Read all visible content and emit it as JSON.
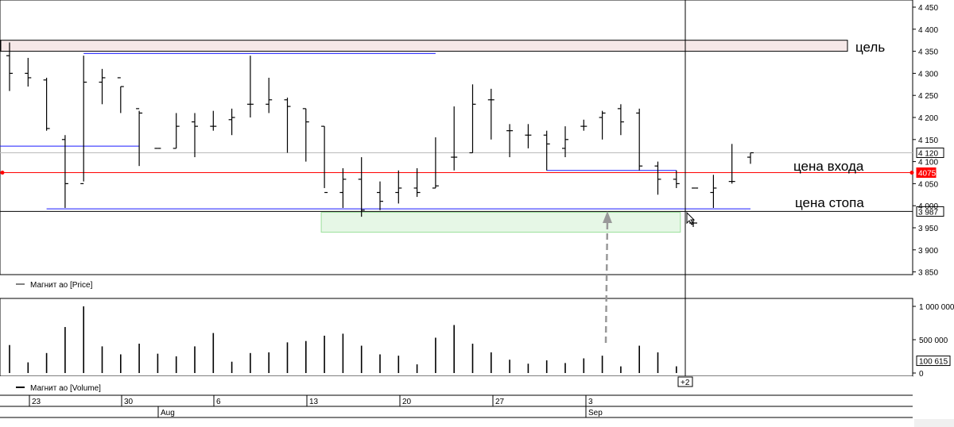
{
  "chart_data": [
    {
      "type": "ohlc",
      "legend": "Магнит ао [Price]",
      "ylim": [
        3840,
        4460
      ],
      "price_ticks": [
        4450,
        4400,
        4350,
        4300,
        4250,
        4200,
        4150,
        4100,
        4050,
        4000,
        3950,
        3900,
        3850
      ],
      "price_tick_labels": [
        "4 450",
        "4 400",
        "4 350",
        "4 300",
        "4 250",
        "4 200",
        "4 150",
        "4 100",
        "4 050",
        "4 000",
        "3 950",
        "3 900",
        "3 850"
      ],
      "bars": [
        {
          "date": "Jul 22",
          "o": 4340,
          "h": 4370,
          "l": 4260,
          "c": 4300
        },
        {
          "date": "Jul 23",
          "o": 4300,
          "h": 4335,
          "l": 4270,
          "c": 4290
        },
        {
          "date": "Jul 24",
          "o": 4285,
          "h": 4290,
          "l": 4170,
          "c": 4175
        },
        {
          "date": "Jul 25",
          "o": 4150,
          "h": 4160,
          "l": 3995,
          "c": 4050
        },
        {
          "date": "Jul 26",
          "o": 4050,
          "h": 4340,
          "l": 4055,
          "c": 4280
        },
        {
          "date": "Jul 29",
          "o": 4280,
          "h": 4310,
          "l": 4230,
          "c": 4290
        },
        {
          "date": "Jul 30",
          "o": 4290,
          "h": 4270,
          "l": 4210,
          "c": 4270
        },
        {
          "date": "Jul 31",
          "o": 4220,
          "h": 4215,
          "l": 4090,
          "c": 4210
        },
        {
          "date": "Aug 1",
          "o": 4130,
          "h": 4130,
          "l": 4130,
          "c": 4130
        },
        {
          "date": "Aug 2",
          "o": 4130,
          "h": 4210,
          "l": 4130,
          "c": 4180
        },
        {
          "date": "Aug 5",
          "o": 4190,
          "h": 4210,
          "l": 4110,
          "c": 4180
        },
        {
          "date": "Aug 6",
          "o": 4180,
          "h": 4215,
          "l": 4170,
          "c": 4180
        },
        {
          "date": "Aug 7",
          "o": 4195,
          "h": 4220,
          "l": 4160,
          "c": 4200
        },
        {
          "date": "Aug 8",
          "o": 4230,
          "h": 4340,
          "l": 4200,
          "c": 4230
        },
        {
          "date": "Aug 9",
          "o": 4230,
          "h": 4290,
          "l": 4210,
          "c": 4240
        },
        {
          "date": "Aug 12",
          "o": 4240,
          "h": 4245,
          "l": 4120,
          "c": 4225
        },
        {
          "date": "Aug 13",
          "o": 4220,
          "h": 4220,
          "l": 4100,
          "c": 4190
        },
        {
          "date": "Aug 14",
          "o": 4180,
          "h": 4180,
          "l": 4040,
          "c": 4030
        },
        {
          "date": "Aug 15",
          "o": 4030,
          "h": 4085,
          "l": 3995,
          "c": 4060
        },
        {
          "date": "Aug 16",
          "o": 4060,
          "h": 4110,
          "l": 3975,
          "c": 3990
        },
        {
          "date": "Aug 19",
          "o": 4030,
          "h": 4055,
          "l": 3990,
          "c": 4010
        },
        {
          "date": "Aug 20",
          "o": 4030,
          "h": 4080,
          "l": 4005,
          "c": 4040
        },
        {
          "date": "Aug 21",
          "o": 4040,
          "h": 4085,
          "l": 4020,
          "c": 4030
        },
        {
          "date": "Aug 22",
          "o": 4040,
          "h": 4155,
          "l": 4040,
          "c": 4045
        },
        {
          "date": "Aug 23",
          "o": 4110,
          "h": 4225,
          "l": 4080,
          "c": 4110
        },
        {
          "date": "Aug 26",
          "o": 4120,
          "h": 4275,
          "l": 4120,
          "c": 4230
        },
        {
          "date": "Aug 27",
          "o": 4240,
          "h": 4265,
          "l": 4150,
          "c": 4240
        },
        {
          "date": "Aug 28",
          "o": 4170,
          "h": 4185,
          "l": 4110,
          "c": 4170
        },
        {
          "date": "Aug 29",
          "o": 4160,
          "h": 4185,
          "l": 4130,
          "c": 4160
        },
        {
          "date": "Aug 30",
          "o": 4160,
          "h": 4170,
          "l": 4080,
          "c": 4140
        },
        {
          "date": "Aug 31",
          "o": 4130,
          "h": 4180,
          "l": 4110,
          "c": 4150
        },
        {
          "date": "Sep 1",
          "o": 4180,
          "h": 4195,
          "l": 4170,
          "c": 4180
        },
        {
          "date": "Sep 2",
          "o": 4200,
          "h": 4215,
          "l": 4150,
          "c": 4210
        },
        {
          "date": "Sep 3",
          "o": 4220,
          "h": 4230,
          "l": 4160,
          "c": 4190
        },
        {
          "date": "Sep 4",
          "o": 4210,
          "h": 4220,
          "l": 4080,
          "c": 4090
        },
        {
          "date": "Sep 5",
          "o": 4090,
          "h": 4100,
          "l": 4025,
          "c": 4060
        },
        {
          "date": "Sep 6",
          "o": 4060,
          "h": 4080,
          "l": 4040,
          "c": 4050
        },
        {
          "date": "Sep 9",
          "o": 4040,
          "h": 4040,
          "l": 4040,
          "c": 4040
        },
        {
          "date": "Sep 10",
          "o": 4030,
          "h": 4070,
          "l": 3995,
          "c": 4040
        },
        {
          "date": "Sep 11",
          "o": 4055,
          "h": 4140,
          "l": 4050,
          "c": 4055
        },
        {
          "date": "Sep 12",
          "o": 4110,
          "h": 4120,
          "l": 4095,
          "c": 4120
        }
      ],
      "annotations": [
        {
          "text": "цель",
          "value": 4360
        },
        {
          "text": "цена входа",
          "value": 4075
        },
        {
          "text": "цена стопа",
          "value": 3987
        }
      ],
      "reference_lines": [
        {
          "value": 4120,
          "label": "4 120",
          "color": "#bbbbbb"
        },
        {
          "value": 4075,
          "label": "4075",
          "color": "#ff0000"
        },
        {
          "value": 3987,
          "label": "3 987",
          "color": "#000000"
        }
      ],
      "drawn_lines": [
        {
          "from": "Jul 26",
          "to": "Aug 22",
          "value": 4345,
          "color": "#1a1aff"
        },
        {
          "from": "Jul 22",
          "to": "Jul 31",
          "value": 4135,
          "color": "#1a1aff"
        },
        {
          "from": "Jul 24",
          "to": "Sep 12",
          "value": 3993,
          "color": "#1a1aff"
        },
        {
          "from": "Aug 30",
          "to": "Sep 6",
          "value": 4080,
          "color": "#1a1aff"
        }
      ],
      "zones": [
        {
          "name": "target-zone",
          "low": 4350,
          "high": 4375,
          "from": "start",
          "to": "end",
          "color": "#f6e8e8"
        },
        {
          "name": "stop-zone",
          "low": 3940,
          "high": 3985,
          "from": "Aug 14",
          "to": "Sep 6",
          "color": "#e6f7e6"
        }
      ]
    },
    {
      "type": "bar",
      "legend": "Магнит ао [Volume]",
      "ylim": [
        0,
        1200000
      ],
      "volume_ticks": [
        1000000,
        500000,
        0
      ],
      "volume_tick_labels": [
        "1 000 000",
        "500 000",
        "0"
      ],
      "last_value_label": "100 615",
      "values": [
        420000,
        160000,
        300000,
        690000,
        1000000,
        400000,
        280000,
        440000,
        290000,
        250000,
        400000,
        600000,
        170000,
        300000,
        310000,
        460000,
        480000,
        560000,
        590000,
        410000,
        280000,
        260000,
        130000,
        530000,
        720000,
        440000,
        310000,
        200000,
        140000,
        190000,
        150000,
        220000,
        260000,
        100000,
        410000,
        310000,
        100615
      ]
    }
  ],
  "time_axis": {
    "day_labels": [
      "23",
      "30",
      "6",
      "13",
      "20",
      "27",
      "3"
    ],
    "month_labels": [
      "Aug",
      "Sep"
    ]
  },
  "cursor_badge": "+2",
  "colors": {
    "bars": "#000000",
    "blue_line": "#1a1aff",
    "entry_line": "#ff0000",
    "stop_line": "#000000",
    "arrow": "#999999"
  }
}
